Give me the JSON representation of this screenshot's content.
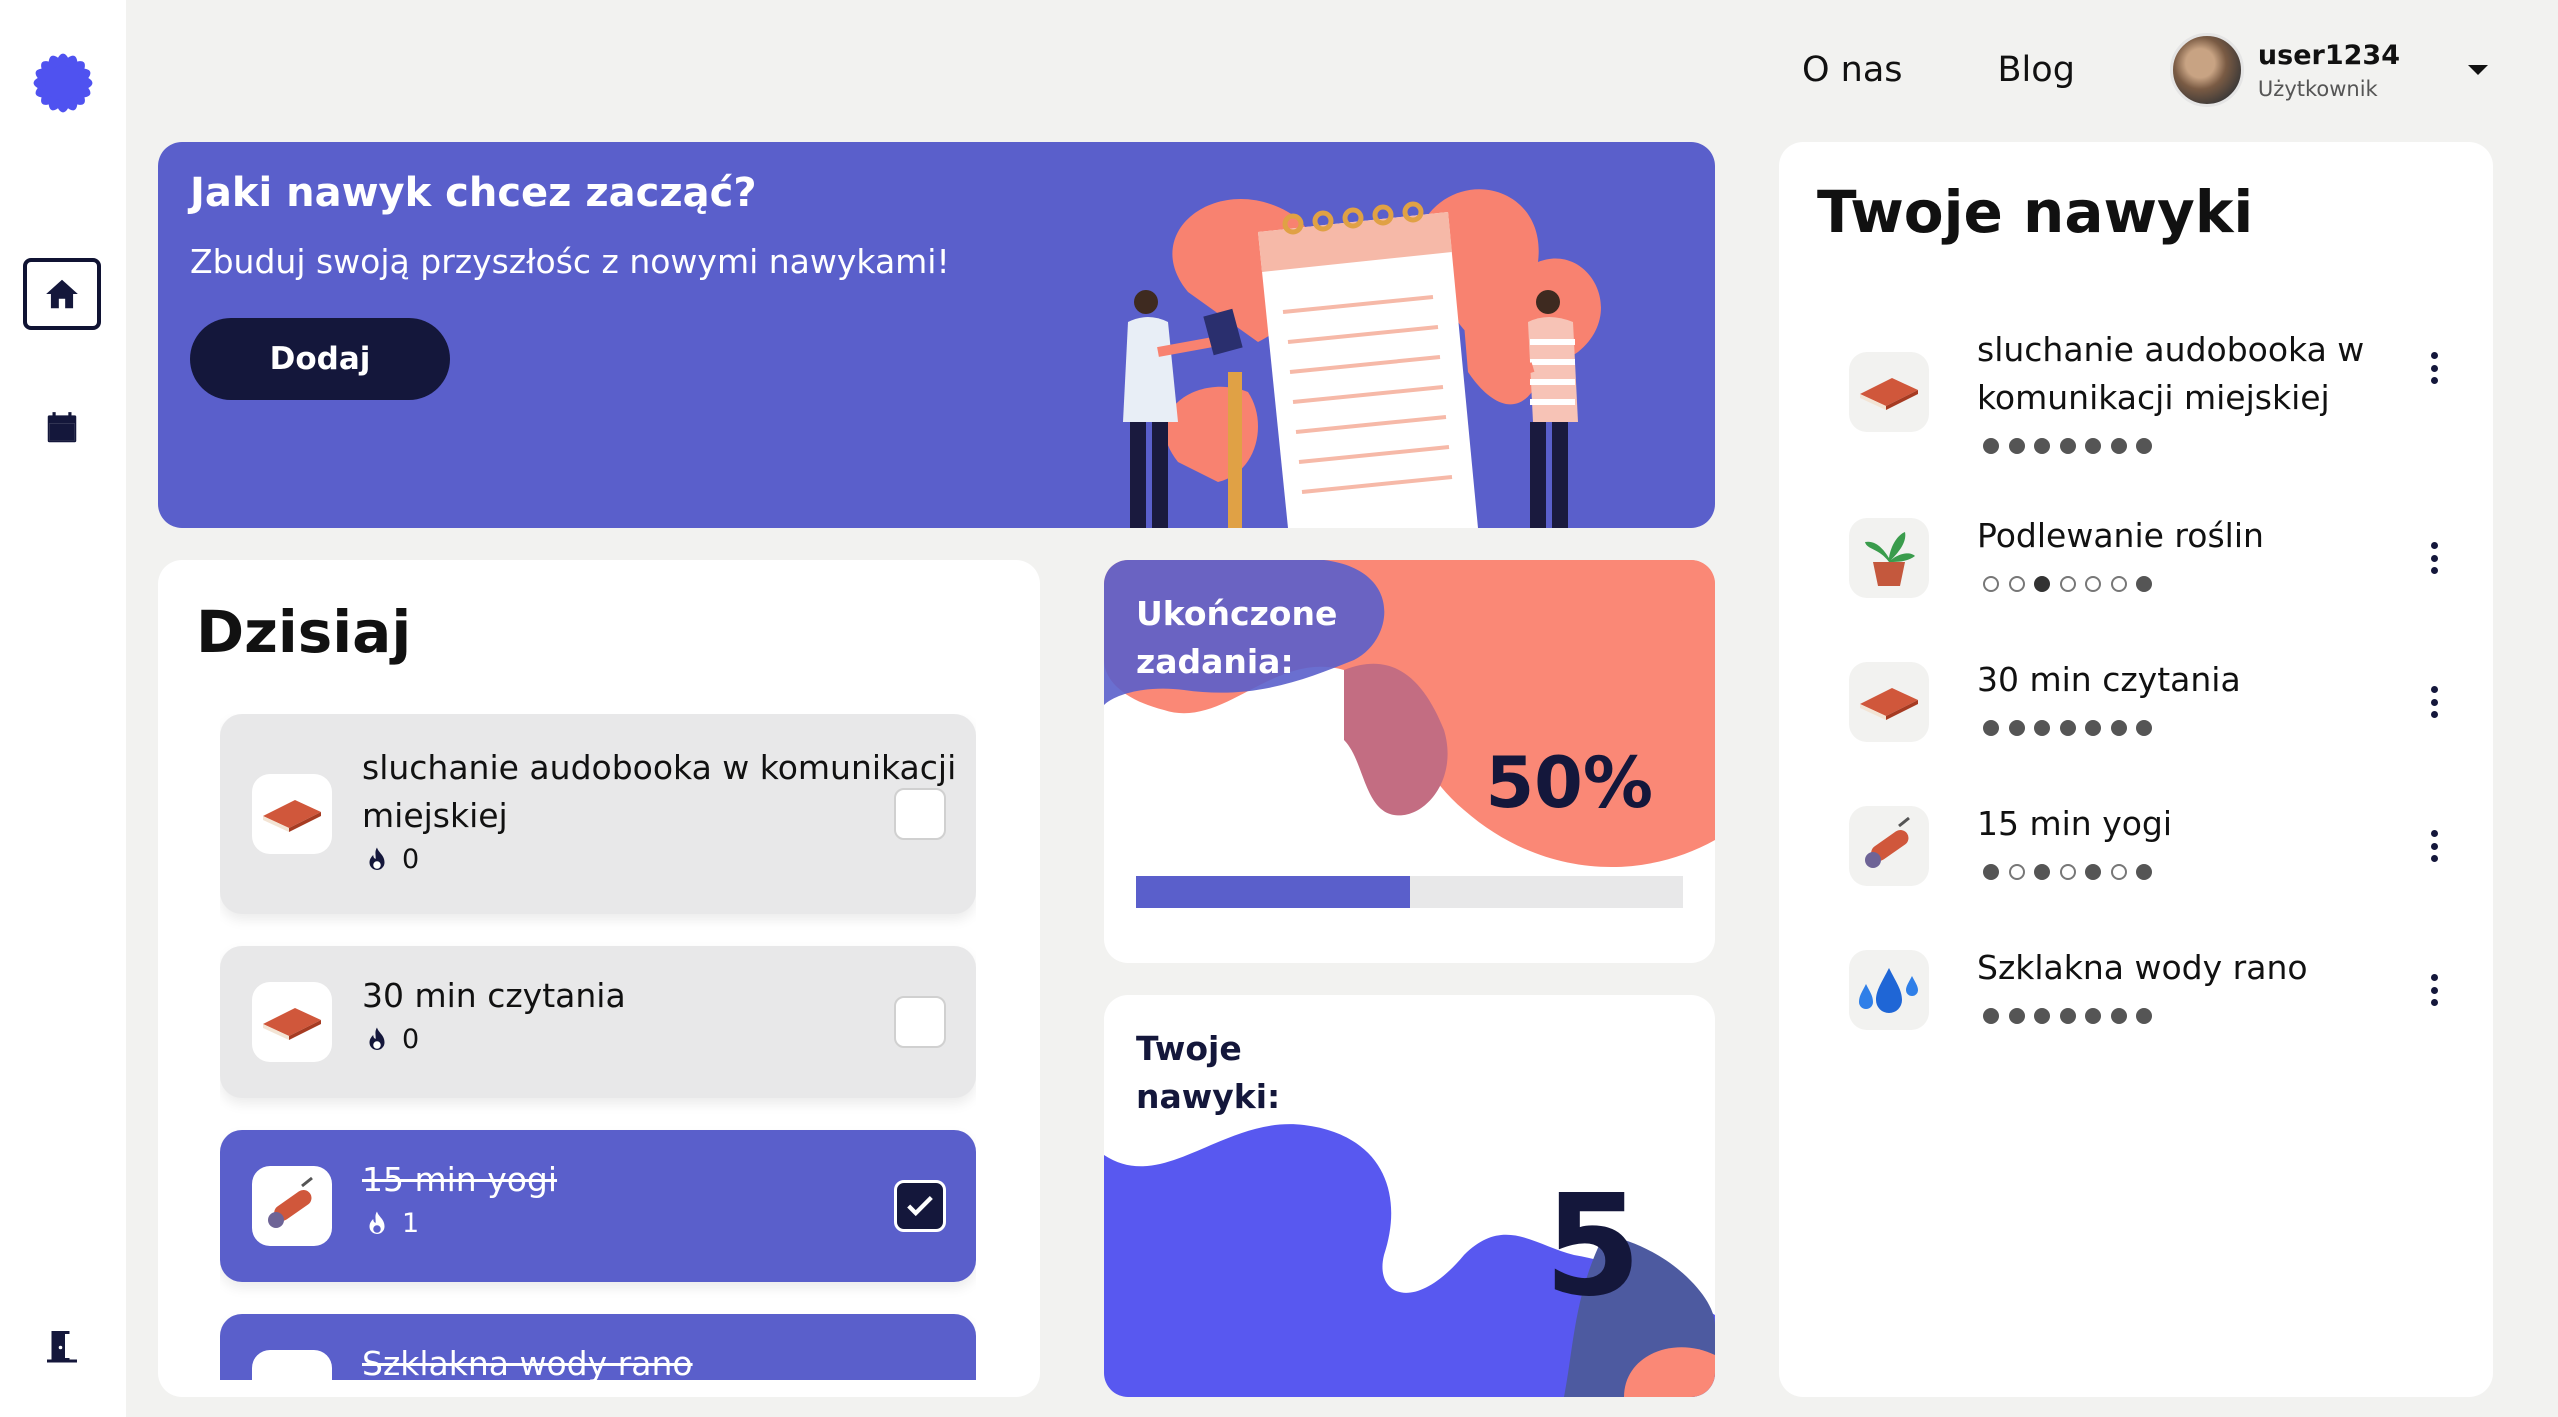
{
  "nav": {
    "links": [
      "O nas",
      "Blog"
    ],
    "user": {
      "name": "user1234",
      "role": "Użytkownik"
    }
  },
  "sidebar": {
    "items": [
      {
        "name": "home",
        "icon": "home-icon",
        "active": true
      },
      {
        "name": "calendar",
        "icon": "calendar-icon",
        "active": false
      }
    ],
    "bottom_icon": "exit-door-icon"
  },
  "banner": {
    "title": "Jaki nawyk chcez zacząć?",
    "subtitle": "Zbuduj swoją przyszłośc z nowymi nawykami!",
    "button": "Dodaj"
  },
  "today": {
    "title": "Dzisiaj",
    "tasks": [
      {
        "name": "sluchanie audobooka w komunikacji miejskiej",
        "streak": "0",
        "done": false,
        "icon": "book-icon"
      },
      {
        "name": "30 min czytania",
        "streak": "0",
        "done": false,
        "icon": "book-icon"
      },
      {
        "name": "15 min yogi",
        "streak": "1",
        "done": true,
        "icon": "yoga-mat-icon"
      },
      {
        "name": "Szklakna wody rano",
        "streak": "",
        "done": true,
        "icon": "water-drops-icon"
      }
    ]
  },
  "stats": {
    "completed": {
      "label": "Ukończone zadania:",
      "value": "50%",
      "progress": 0.5
    },
    "habits_count": {
      "label": "Twoje nawyki:",
      "value": "5"
    }
  },
  "habits": {
    "title": "Twoje nawyki",
    "items": [
      {
        "name": "sluchanie audobooka w komunikacji miejskiej",
        "icon": "book-icon",
        "dots": [
          "f",
          "f",
          "f",
          "f",
          "f",
          "f",
          "f"
        ]
      },
      {
        "name": "Podlewanie roślin",
        "icon": "plant-icon",
        "dots": [
          "e",
          "e",
          "c",
          "e",
          "e",
          "e",
          "f"
        ]
      },
      {
        "name": "30 min czytania",
        "icon": "book-icon",
        "dots": [
          "f",
          "f",
          "f",
          "f",
          "f",
          "f",
          "f"
        ]
      },
      {
        "name": "15 min yogi",
        "icon": "yoga-mat-icon",
        "dots": [
          "f",
          "e",
          "f",
          "e",
          "f",
          "e",
          "f"
        ]
      },
      {
        "name": "Szklakna wody rano",
        "icon": "water-drops-icon",
        "dots": [
          "f",
          "f",
          "f",
          "f",
          "f",
          "f",
          "f"
        ]
      }
    ]
  },
  "colors": {
    "accent": "#5a5fcb",
    "dark": "#14173b",
    "coral": "#fa8876",
    "blue": "#5858f0"
  }
}
